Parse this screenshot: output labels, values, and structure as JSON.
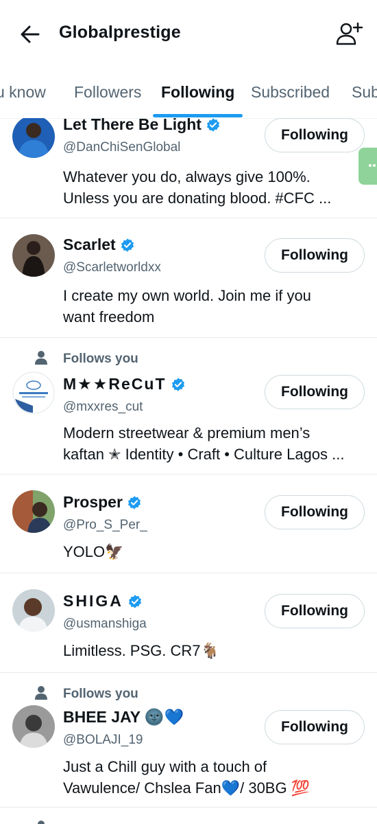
{
  "header": {
    "title": "Globalprestige"
  },
  "tabs": [
    {
      "label": "u know"
    },
    {
      "label": "Followers"
    },
    {
      "label": "Following"
    },
    {
      "label": "Subscribed"
    },
    {
      "label": "Sub"
    }
  ],
  "colors": {
    "accent": "#1d9bf0",
    "verified": "#1d9bf0",
    "text": "#0f1419",
    "muted": "#536471"
  },
  "users": [
    {
      "name": "Let There Be Light",
      "handle": "@DanChiSenGlobal",
      "bio_line1": "Whatever you do, always give 100%.",
      "bio_line2": "Unless you are donating blood. #CFC ...",
      "button": "Following"
    },
    {
      "name": "Scarlet",
      "handle": "@Scarletworldxx",
      "bio_line1": "I create my own world. Join me if you",
      "bio_line2": "want freedom",
      "button": "Following"
    },
    {
      "follows_you": "Follows you",
      "name": "M★★ReCuT",
      "handle": "@mxxres_cut",
      "bio_line1": "Modern streetwear & premium men’s",
      "bio_line2": "kaftan ✭ Identity • Craft • Culture Lagos ...",
      "button": "Following"
    },
    {
      "name": "Prosper",
      "handle": "@Pro_S_Per_",
      "bio_line1": "YOLO🦅",
      "button": "Following"
    },
    {
      "name": "SHIGA",
      "handle": "@usmanshiga",
      "bio_line1": "Limitless. PSG. CR7🐐",
      "button": "Following"
    },
    {
      "follows_you": "Follows you",
      "name": "BHEE JAY 🌚💙",
      "handle": "@BOLAJI_19",
      "bio_line1": "Just a Chill guy with a touch of",
      "bio_line2": "Vawulence/ Chslea Fan💙/ 30BG 💯",
      "button": "Following"
    }
  ]
}
